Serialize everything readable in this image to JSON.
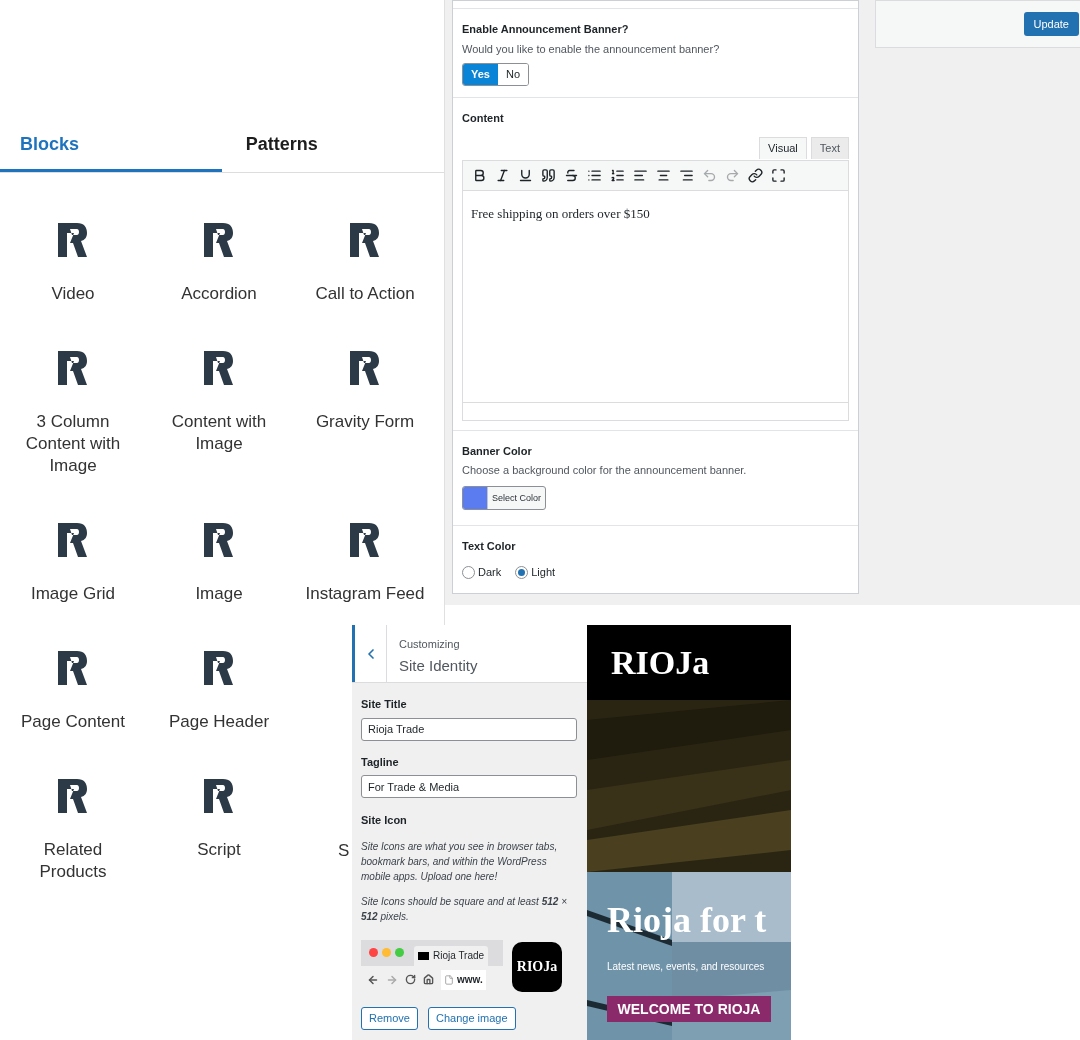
{
  "inserter": {
    "tabs": [
      {
        "label": "Blocks",
        "selected": true
      },
      {
        "label": "Patterns",
        "selected": false
      }
    ],
    "rows": [
      [
        {
          "label": "Video",
          "kind": "block"
        },
        {
          "label": "Accordion",
          "kind": "block"
        },
        {
          "label": "Call to Action",
          "kind": "block"
        }
      ],
      [
        {
          "label": "3 Column Content with Image",
          "kind": "block"
        },
        {
          "label": "Content with Image",
          "kind": "block"
        },
        {
          "label": "Gravity Form",
          "kind": "block"
        }
      ],
      [
        {
          "label": "Image Grid",
          "kind": "block"
        },
        {
          "label": "Image",
          "kind": "block"
        },
        {
          "label": "Instagram Feed",
          "kind": "block"
        }
      ],
      [
        {
          "label": "Page Content",
          "kind": "block"
        },
        {
          "label": "Page Header",
          "kind": "block"
        }
      ],
      [
        {
          "label": "Related Products",
          "kind": "block"
        },
        {
          "label": "Script",
          "kind": "block"
        },
        {
          "label": "S",
          "kind": "cut"
        }
      ]
    ]
  },
  "fields": {
    "enable": {
      "label": "Enable Announcement Banner?",
      "description": "Would you like to enable the announcement banner?",
      "options": [
        {
          "label": "Yes",
          "selected": true
        },
        {
          "label": "No",
          "selected": false
        }
      ]
    },
    "content": {
      "label": "Content",
      "tabs": [
        {
          "label": "Visual",
          "selected": true
        },
        {
          "label": "Text",
          "selected": false
        }
      ],
      "toolbar": [
        {
          "kind": "bold",
          "disabled": false
        },
        {
          "kind": "italic",
          "disabled": false
        },
        {
          "kind": "underline",
          "disabled": false
        },
        {
          "kind": "quote",
          "disabled": false
        },
        {
          "kind": "strike",
          "disabled": false
        },
        {
          "kind": "bullets",
          "disabled": false
        },
        {
          "kind": "numbers",
          "disabled": false
        },
        {
          "kind": "left",
          "disabled": false
        },
        {
          "kind": "center",
          "disabled": false
        },
        {
          "kind": "right",
          "disabled": false
        },
        {
          "kind": "undo",
          "disabled": true
        },
        {
          "kind": "redo",
          "disabled": true
        },
        {
          "kind": "link",
          "disabled": false
        },
        {
          "kind": "fullscreen",
          "disabled": false
        }
      ],
      "value": "Free shipping on orders over $150"
    },
    "banner_color": {
      "label": "Banner Color",
      "description": "Choose a background color for the announcement banner.",
      "color": "#5b7cf0",
      "button": "Select Color"
    },
    "text_color": {
      "label": "Text Color",
      "options": [
        {
          "label": "Dark",
          "selected": false
        },
        {
          "label": "Light",
          "selected": true
        }
      ]
    }
  },
  "publish": {
    "button": "Update"
  },
  "customizer": {
    "breadcrumb": "Customizing",
    "title": "Site Identity",
    "site_title": {
      "label": "Site Title",
      "value": "Rioja Trade"
    },
    "tagline": {
      "label": "Tagline",
      "value": "For Trade & Media"
    },
    "site_icon": {
      "label": "Site Icon",
      "notes": [
        "Site Icons are what you see in browser tabs, bookmark bars, and within the WordPress mobile apps. Upload one here!",
        "Site Icons should be square and at least **512** × **512** pixels."
      ],
      "browser_tab": "Rioja Trade",
      "address": "www.",
      "icon_text": "RIOJa"
    },
    "buttons": [
      "Remove",
      "Change image"
    ]
  },
  "preview": {
    "logo": "RIOJa",
    "heading": "Rioja for t",
    "subheading": "Latest news, events, and resources",
    "button": "WELCOME TO RIOJA"
  }
}
